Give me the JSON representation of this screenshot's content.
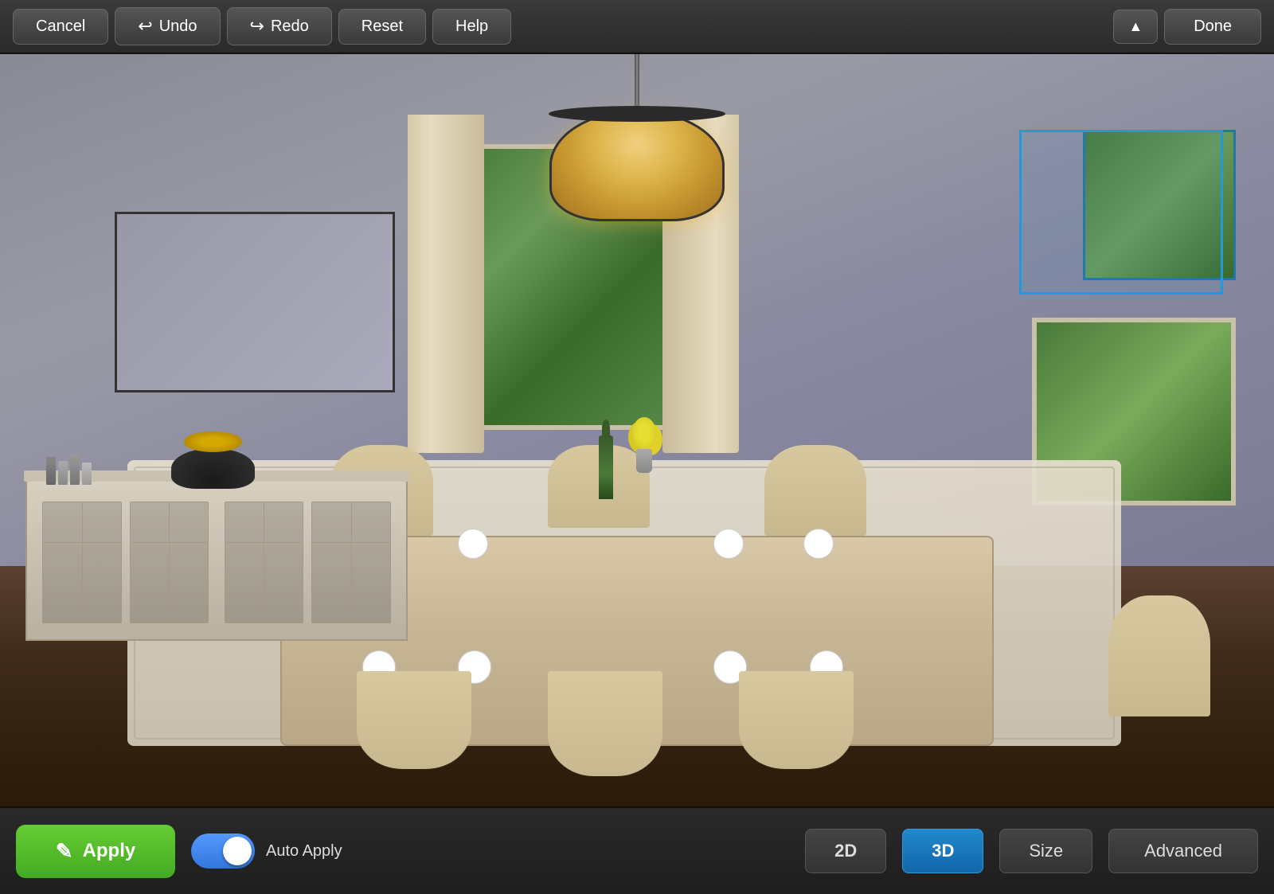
{
  "toolbar": {
    "cancel_label": "Cancel",
    "undo_label": "Undo",
    "redo_label": "Redo",
    "reset_label": "Reset",
    "help_label": "Help",
    "done_label": "Done",
    "collapse_icon": "▲"
  },
  "bottom_bar": {
    "apply_label": "Apply",
    "auto_apply_label": "Auto Apply",
    "view_2d_label": "2D",
    "view_3d_label": "3D",
    "size_label": "Size",
    "advanced_label": "Advanced",
    "active_view": "3D"
  },
  "icons": {
    "undo_icon": "↩",
    "redo_icon": "↪",
    "apply_icon": "✎"
  }
}
